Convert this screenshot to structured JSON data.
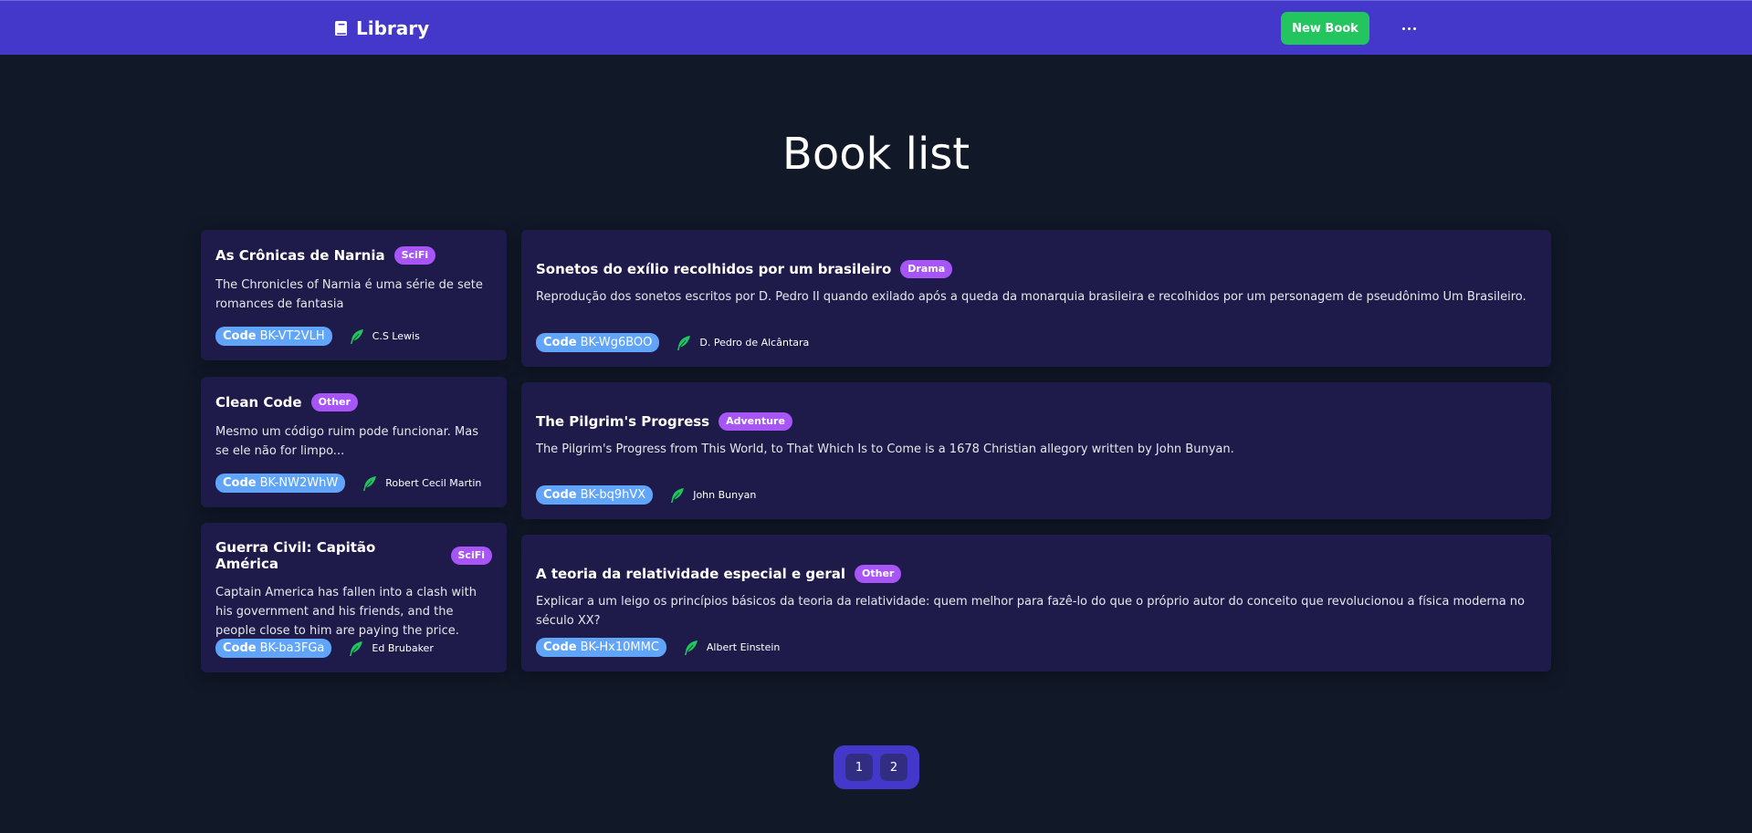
{
  "navbar": {
    "brand": "Library",
    "brand_icon": "book-icon",
    "new_book_label": "New Book",
    "more_icon": "ellipsis-icon",
    "background": "#4338ca",
    "new_book_color": "#22c55e"
  },
  "page_title": "Book list",
  "colors": {
    "card_bg": "#1e1b4b",
    "genre_badge": "#a855f7",
    "code_pill": "#60a5fa",
    "feather_icon": "#22c55e",
    "page_bg": "#111827"
  },
  "code_label": "Code",
  "books": [
    {
      "title": "As Crônicas de Narnia",
      "genre": "SciFi",
      "description": "The Chronicles of Narnia é uma série de sete romances de fantasia",
      "code": "BK-VT2VLH",
      "author": "C.S Lewis"
    },
    {
      "title": "Clean Code",
      "genre": "Other",
      "description": "Mesmo um código ruim pode funcionar. Mas se ele não for limpo...",
      "code": "BK-NW2WhW",
      "author": "Robert Cecil Martin"
    },
    {
      "title": "Guerra Civil: Capitão América",
      "genre": "SciFi",
      "description": "Captain America has fallen into a clash with his government and his friends, and the people close to him are paying the price.",
      "code": "BK-ba3FGa",
      "author": "Ed Brubaker"
    },
    {
      "title": "Sonetos do exílio recolhidos por um brasileiro",
      "genre": "Drama",
      "description": "Reprodução dos sonetos escritos por D. Pedro II quando exilado após a queda da monarquia brasileira e recolhidos por um personagem de pseudônimo Um Brasileiro.",
      "code": "BK-Wg6BOO",
      "author": "D. Pedro de Alcântara"
    },
    {
      "title": "The Pilgrim's Progress",
      "genre": "Adventure",
      "description": "The Pilgrim's Progress from This World, to That Which Is to Come is a 1678 Christian allegory written by John Bunyan.",
      "code": "BK-bq9hVX",
      "author": "John Bunyan"
    },
    {
      "title": "A teoria da relatividade especial e geral",
      "genre": "Other",
      "description": "Explicar a um leigo os princípios básicos da teoria da relatividade: quem melhor para fazê-lo do que o próprio autor do conceito que revolucionou a física moderna no século XX?",
      "code": "BK-Hx10MMC",
      "author": "Albert Einstein"
    }
  ],
  "pagination": {
    "pages": [
      "1",
      "2"
    ]
  }
}
